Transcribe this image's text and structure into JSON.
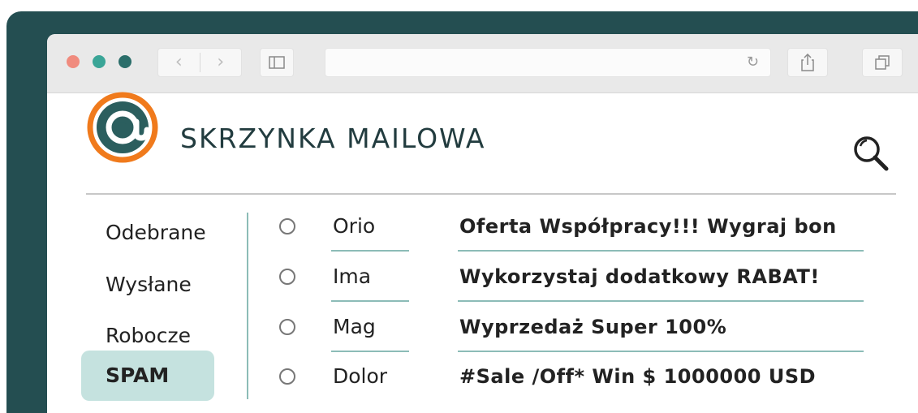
{
  "app": {
    "title": "SKRZYNKA MAILOWA",
    "logo_symbol": "@"
  },
  "browser": {
    "address": "",
    "back_label": "‹",
    "forward_label": "›",
    "reload_label": "↻"
  },
  "sidebar": {
    "items": [
      {
        "label": "Odebrane",
        "active": false
      },
      {
        "label": "Wysłane",
        "active": false
      },
      {
        "label": "Robocze",
        "active": false
      },
      {
        "label": "SPAM",
        "active": true
      }
    ]
  },
  "messages": [
    {
      "sender": "Orio",
      "subject": "Oferta Współpracy!!! Wygraj bon"
    },
    {
      "sender": "Ima",
      "subject": "Wykorzystaj dodatkowy RABAT!"
    },
    {
      "sender": "Mag",
      "subject": "Wyprzedaż Super 100%"
    },
    {
      "sender": "Dolor",
      "subject": "#Sale /Off* Win $ 1000000 USD"
    }
  ],
  "icons": [
    "search-icon",
    "share-icon",
    "tabs-icon",
    "sidebar-toggle-icon",
    "reload-icon"
  ],
  "colors": {
    "frame": "#244e51",
    "accent_orange": "#f07a1c",
    "logo_teal": "#2b5e5e",
    "active_folder": "#c5e2df",
    "divider": "#8cbcb7"
  }
}
